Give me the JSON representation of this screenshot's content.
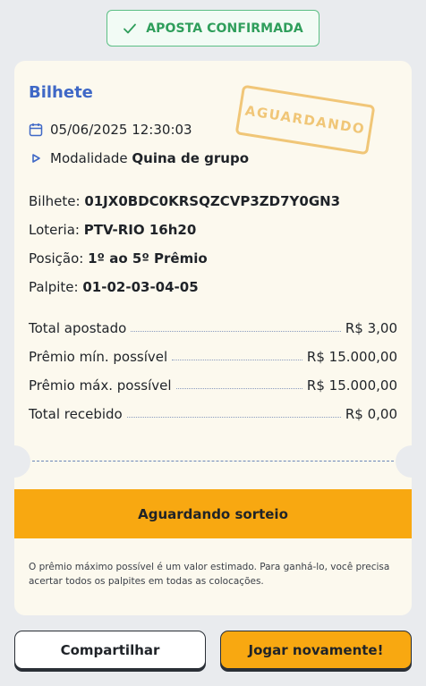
{
  "badge": {
    "label": "APOSTA CONFIRMADA",
    "icon": "check-icon",
    "color": "#2f9e5b"
  },
  "ticket": {
    "title": "Bilhete",
    "stamp": "AGUARDANDO",
    "datetime": "05/06/2025 12:30:03",
    "modality_prefix": "Modalidade",
    "modality_value": "Quina de grupo",
    "details": [
      {
        "label": "Bilhete:",
        "value": "01JX0BDC0KRSQZCVP3ZD7Y0GN3"
      },
      {
        "label": "Loteria:",
        "value": "PTV-RIO 16h20"
      },
      {
        "label": "Posição:",
        "value": "1º ao 5º Prêmio"
      },
      {
        "label": "Palpite:",
        "value": "01-02-03-04-05"
      }
    ],
    "summary": [
      {
        "label": "Total apostado",
        "value": "R$ 3,00"
      },
      {
        "label": "Prêmio mín. possível",
        "value": "R$ 15.000,00"
      },
      {
        "label": "Prêmio máx. possível",
        "value": "R$ 15.000,00"
      },
      {
        "label": "Total recebido",
        "value": "R$ 0,00"
      }
    ],
    "status": "Aguardando sorteio",
    "note": "O prêmio máximo possível é um valor estimado. Para ganhá-lo, você precisa acertar todos os palpites em todas as colocações."
  },
  "actions": {
    "share": "Compartilhar",
    "play_again": "Jogar novamente!"
  },
  "colors": {
    "accent": "#f8a811",
    "title": "#3f68c6",
    "stamp": "#efbe63"
  }
}
